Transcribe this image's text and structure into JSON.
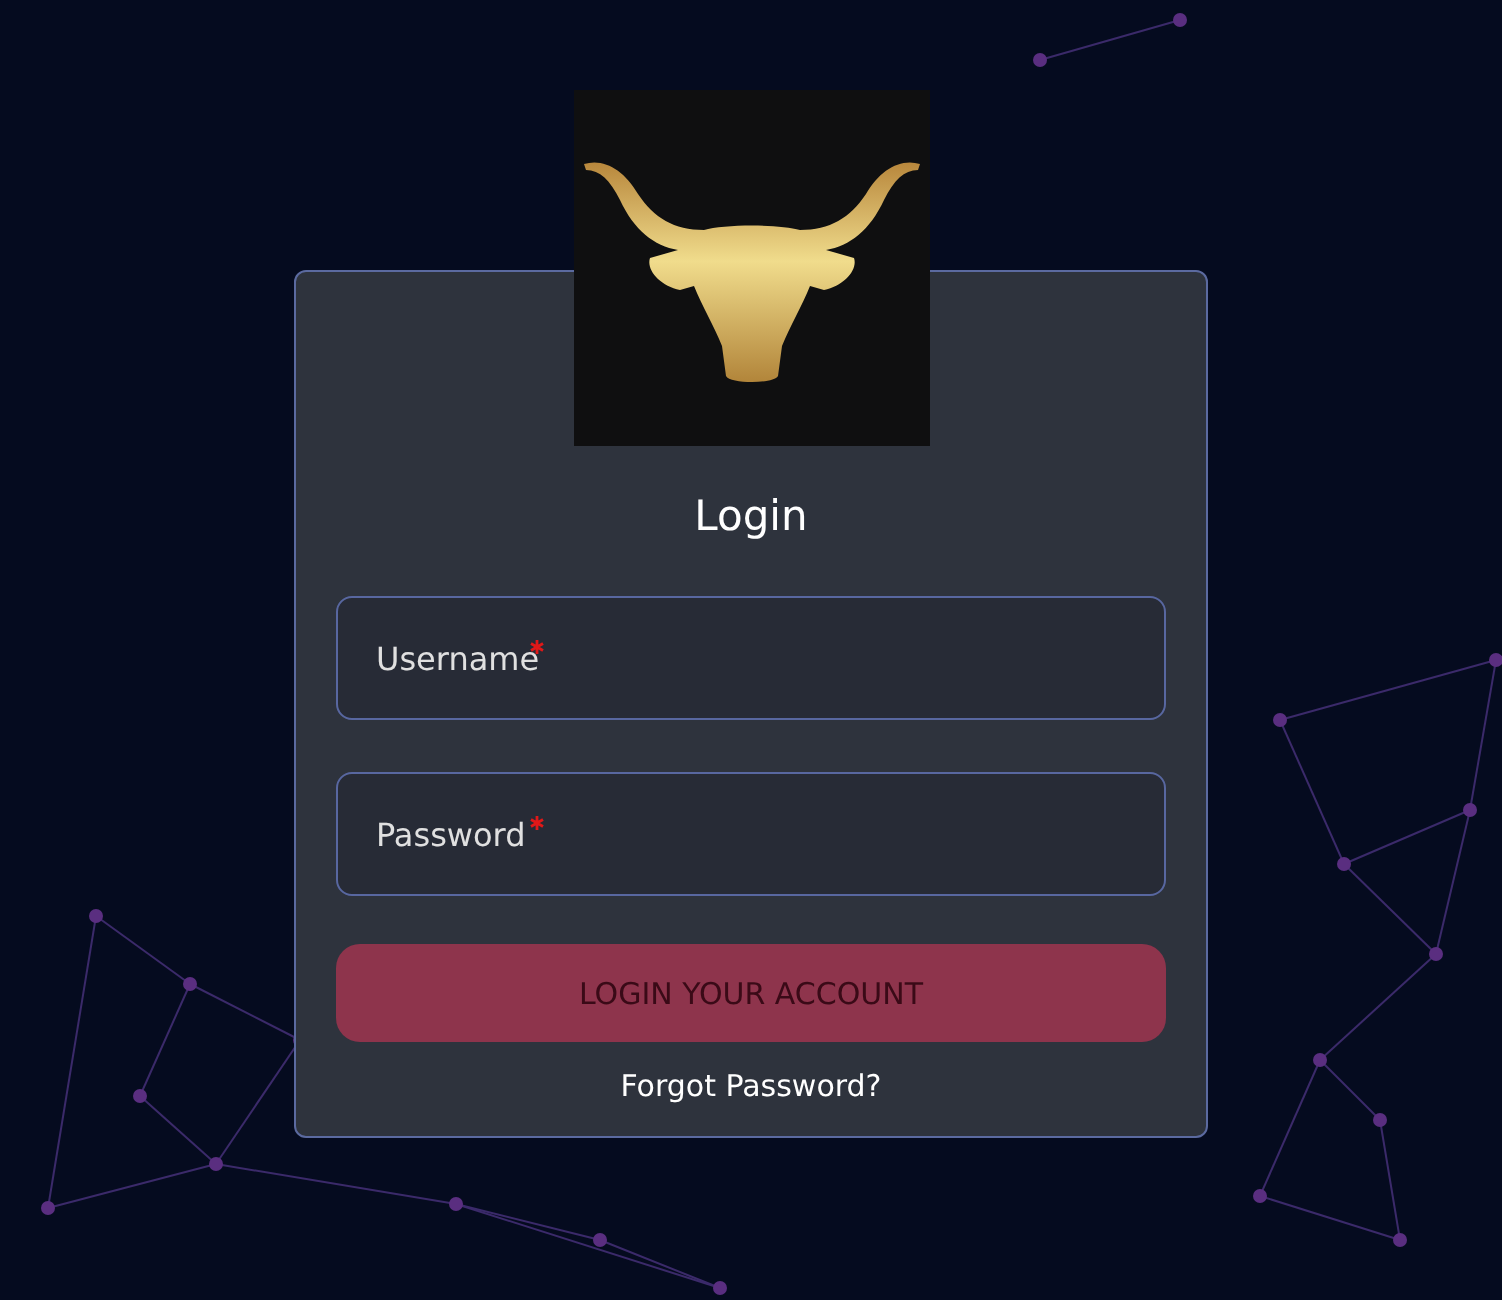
{
  "title": "Login",
  "fields": [
    {
      "placeholder": "Username",
      "required": true
    },
    {
      "placeholder": "Password",
      "required": true
    }
  ],
  "submit": {
    "label": "LOGIN YOUR ACCOUNT",
    "disabled": true
  },
  "forgot_link": "Forgot Password?"
}
